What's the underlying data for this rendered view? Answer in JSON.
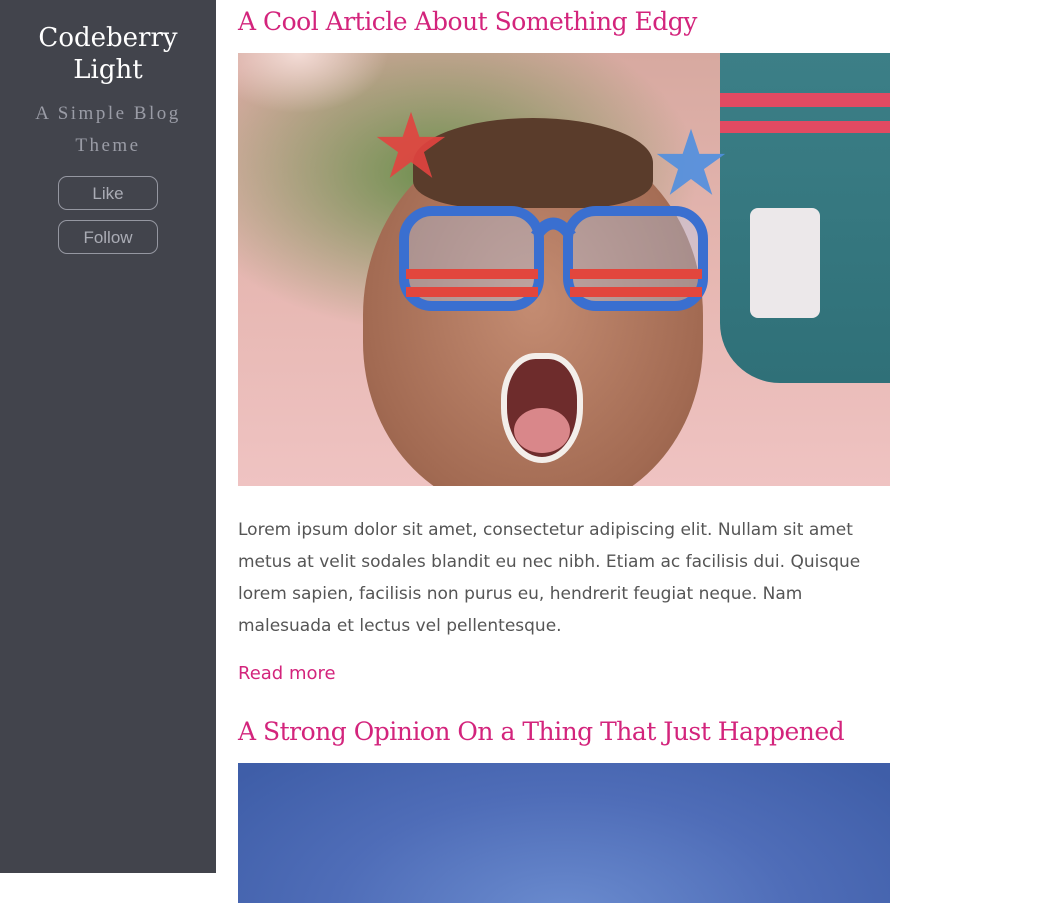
{
  "sidebar": {
    "site_title": "Codeberry Light",
    "tagline": "A Simple Blog Theme",
    "like_label": "Like",
    "follow_label": "Follow"
  },
  "posts": [
    {
      "title": "A Cool Article About Something Edgy",
      "excerpt": "Lorem ipsum dolor sit amet, consectetur adipiscing elit. Nullam sit amet metus at velit sodales blandit eu nec nibh. Etiam ac facilisis dui. Quisque lorem sapien, facilisis non purus eu, hendrerit feugiat neque. Nam malesuada et lectus vel pellentesque.",
      "read_more": "Read more"
    },
    {
      "title": "A Strong Opinion On a Thing That Just Happened"
    }
  ],
  "colors": {
    "sidebar_bg": "#42444c",
    "accent": "#d3247c",
    "body_text": "#555555"
  }
}
